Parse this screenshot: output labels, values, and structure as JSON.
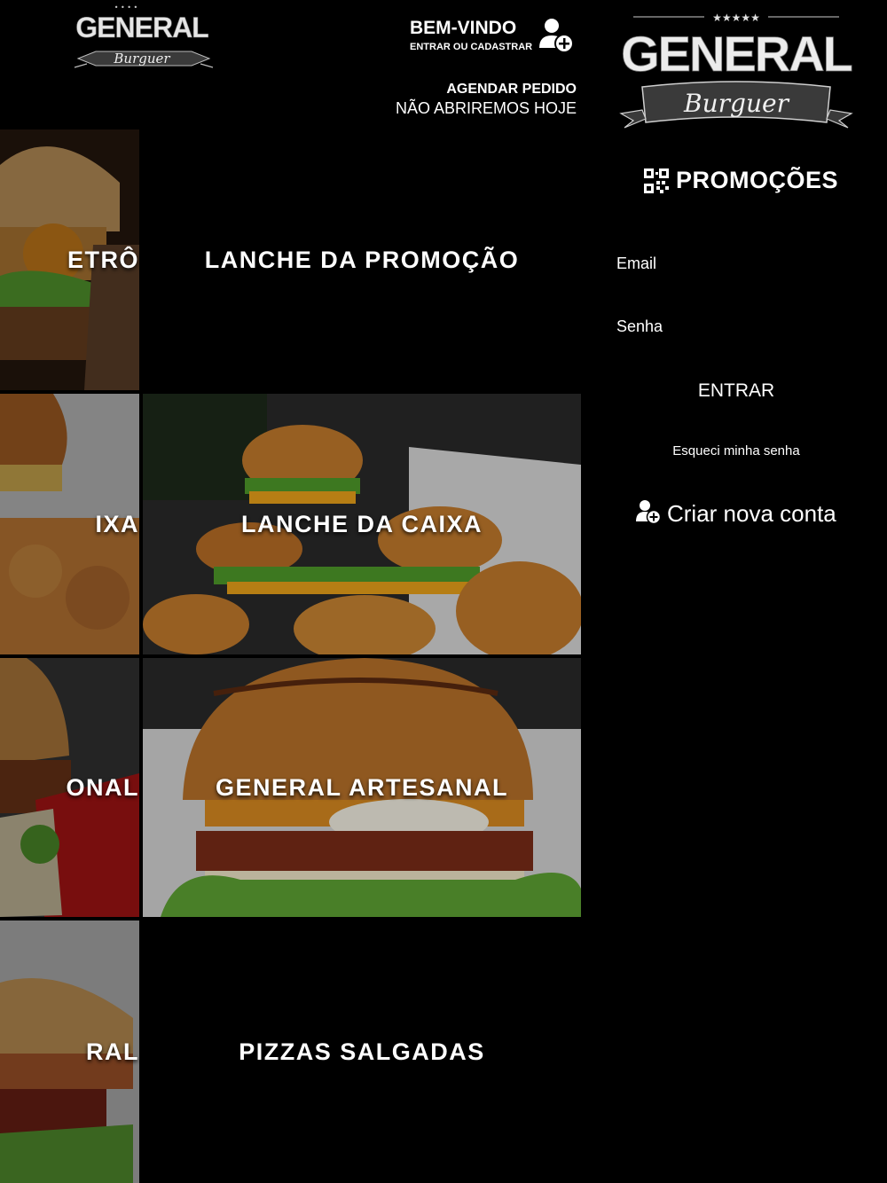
{
  "header": {
    "logo_small": {
      "brand": "GENERAL",
      "tagline": "Burguer"
    },
    "welcome_title": "BEM-VINDO",
    "welcome_sub": "ENTRAR OU CADASTRAR",
    "schedule_link": "AGENDAR PEDIDO",
    "schedule_status": "NÃO ABRIREMOS HOJE"
  },
  "tiles": {
    "left_column": [
      {
        "label": "RETRÔ",
        "visible_text": "ETRÔ"
      },
      {
        "label": "CAIXA",
        "visible_text": "IXA"
      },
      {
        "label": "TRADICIONAL",
        "visible_text": "ONAL"
      },
      {
        "label": "GERAL",
        "visible_text": "RAL"
      }
    ],
    "main_column": [
      {
        "label": "LANCHE DA PROMOÇÃO",
        "has_image": false
      },
      {
        "label": "LANCHE DA CAIXA",
        "has_image": true
      },
      {
        "label": "GENERAL ARTESANAL",
        "has_image": true
      },
      {
        "label": "PIZZAS SALGADAS",
        "has_image": false
      }
    ]
  },
  "sidebar": {
    "logo_big": {
      "brand": "GENERAL",
      "tagline": "Burguer"
    },
    "promo_label": "PROMOÇÕES",
    "email_label": "Email",
    "email_value": "",
    "password_label": "Senha",
    "password_value": "",
    "login_button": "ENTRAR",
    "forgot_password": "Esqueci minha senha",
    "create_account": "Criar nova conta"
  },
  "icons": {
    "user_add": "user-add-icon",
    "qr": "qr-code-icon",
    "create_account": "user-add-icon"
  },
  "colors": {
    "background": "#000000",
    "text": "#ffffff",
    "banner": "#3a3a3a",
    "bun": "#c27a2c",
    "lettuce": "#4f9a2a",
    "cheese": "#e9a21a"
  }
}
